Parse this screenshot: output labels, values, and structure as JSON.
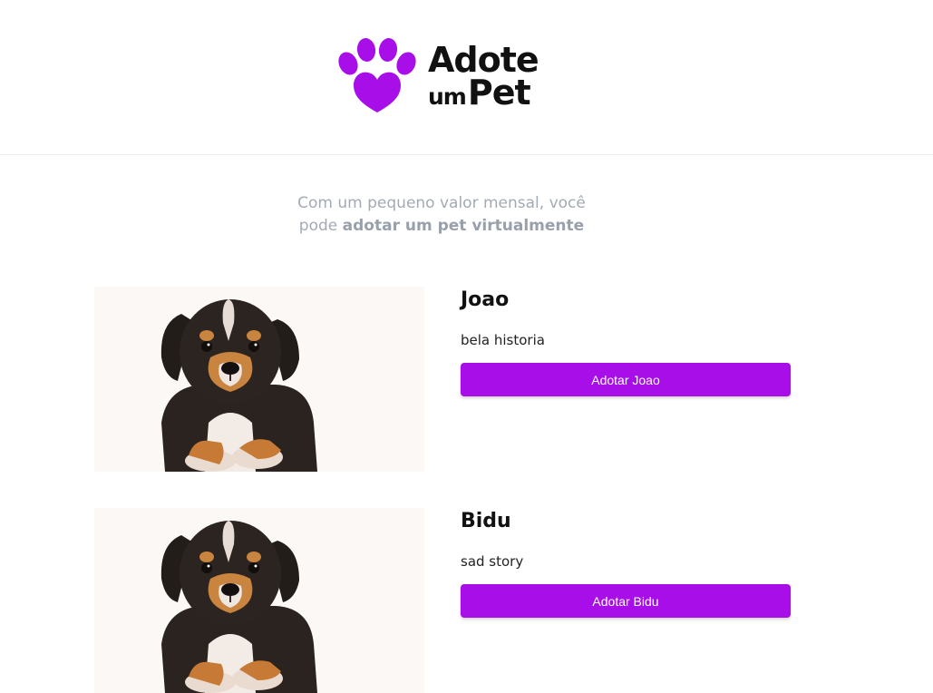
{
  "header": {
    "logo": {
      "line1": "Adote",
      "line2_small": "um",
      "line2_big": "Pet",
      "icon": "paw-icon",
      "color": "#a80fe8"
    }
  },
  "tagline": {
    "prefix": "Com um pequeno valor mensal, você pode",
    "emphasis": "adotar um pet virtualmente"
  },
  "pets": [
    {
      "name": "Joao",
      "story": "bela historia",
      "button_label": "Adotar Joao",
      "photo": "puppy-photo"
    },
    {
      "name": "Bidu",
      "story": "sad story",
      "button_label": "Adotar Bidu",
      "photo": "puppy-photo"
    }
  ],
  "colors": {
    "accent": "#a80fe8",
    "tagline_text": "#a3aab5",
    "divider": "#ececec"
  }
}
